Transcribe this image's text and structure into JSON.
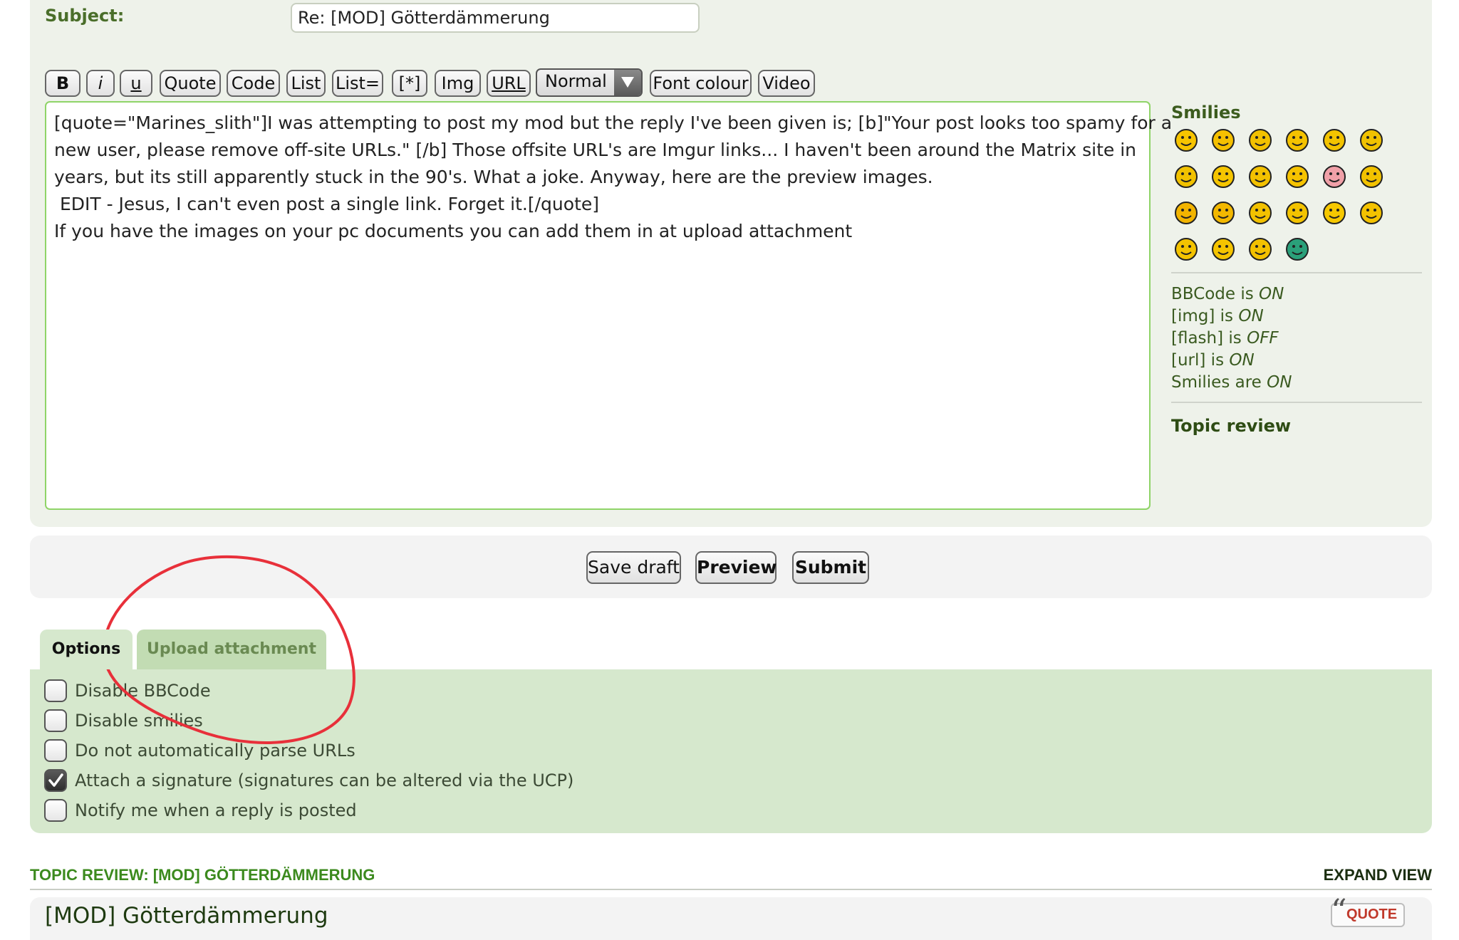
{
  "subject": {
    "label": "Subject:",
    "value": "Re: [MOD] Götterdämmerung"
  },
  "toolbar": {
    "bold": "B",
    "italic": "i",
    "underline": "u",
    "quote": "Quote",
    "code": "Code",
    "list": "List",
    "list_ordered": "List=",
    "list_item": "[*]",
    "img": "Img",
    "url": "URL",
    "font_size_selected": "Normal",
    "font_colour": "Font colour",
    "video": "Video"
  },
  "editor": {
    "lines": [
      "[quote=\"Marines_slith\"]I was attempting to post my mod but the reply I've been given is; [b]\"Your post looks too spamy for a",
      "new user, please remove off-site URLs.\" [/b] Those offsite URL's are Imgur links... I haven't been around the Matrix site in",
      "years, but its still apparently stuck in the 90's. What a joke. Anyway, here are the preview images.",
      "",
      " EDIT - Jesus, I can't even post a single link. Forget it.[/quote]",
      "If you have the images on your pc documents you can add them in at upload attachment"
    ]
  },
  "sidebar": {
    "smilies_title": "Smilies",
    "smilies": [
      "very-happy-icon",
      "smile-icon",
      "sad-icon",
      "surprised-icon",
      "shocked-icon",
      "confused-icon",
      "cool-icon",
      "laughing-icon",
      "mad-icon",
      "razz-icon",
      "embarrassed-icon",
      "crying-icon",
      "evil-icon",
      "twisted-evil-icon",
      "rolling-eyes-icon",
      "wink-icon",
      "exclamation-icon",
      "question-icon",
      "idea-icon",
      "arrow-icon",
      "neutral-icon",
      "mr-green-icon"
    ],
    "status": [
      {
        "prefix": "BBCode is ",
        "value": "ON"
      },
      {
        "prefix": "[img] is ",
        "value": "ON"
      },
      {
        "prefix": "[flash] is ",
        "value": "OFF"
      },
      {
        "prefix": "[url] is ",
        "value": "ON"
      },
      {
        "prefix": "Smilies are ",
        "value": "ON"
      }
    ],
    "topic_review": "Topic review"
  },
  "actions": {
    "save_draft": "Save draft",
    "preview": "Preview",
    "submit": "Submit"
  },
  "tabs": {
    "options": "Options",
    "upload": "Upload attachment"
  },
  "options": [
    {
      "label": "Disable BBCode",
      "checked": false
    },
    {
      "label": "Disable smilies",
      "checked": false
    },
    {
      "label": "Do not automatically parse URLs",
      "checked": false
    },
    {
      "label": "Attach a signature (signatures can be altered via the UCP)",
      "checked": true
    },
    {
      "label": "Notify me when a reply is posted",
      "checked": false
    }
  ],
  "review": {
    "header": "TOPIC REVIEW: [MOD] GÖTTERDÄMMERUNG",
    "expand": "EXPAND VIEW",
    "post_title": "[MOD] Götterdämmerung",
    "quote_label": "QUOTE"
  },
  "colors": {
    "accent_green": "#3c8a1e",
    "annotation_red": "#e8303a",
    "editor_border": "#8fd468"
  }
}
